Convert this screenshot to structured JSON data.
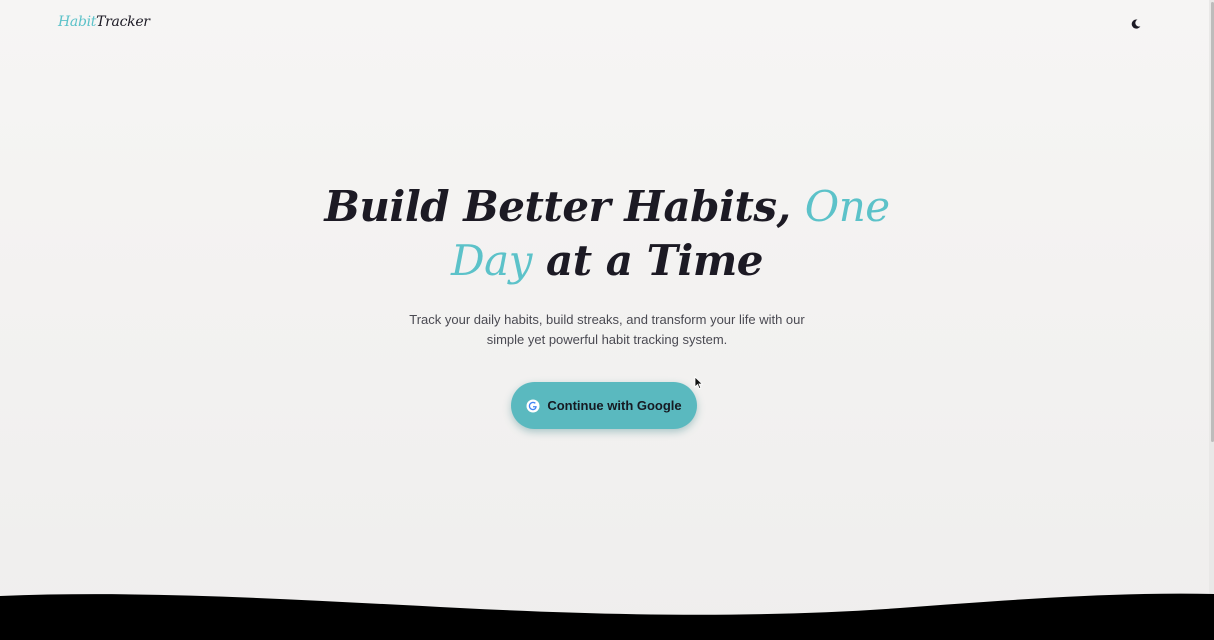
{
  "header": {
    "logo_part1": "Habit",
    "logo_part2": "Tracker",
    "theme_toggle_icon": "moon-icon"
  },
  "hero": {
    "headline_part1": "Build Better Habits, ",
    "headline_accent": "One Day",
    "headline_part2": " at a Time",
    "subtitle": "Track your daily habits, build streaks, and transform your life with our simple yet powerful habit tracking system.",
    "cta_label": "Continue with Google",
    "cta_icon": "google-icon"
  },
  "colors": {
    "accent": "#5cc2c9",
    "button": "#5ab9bf",
    "text_dark": "#1c1a24",
    "footer_wave": "#000000"
  }
}
